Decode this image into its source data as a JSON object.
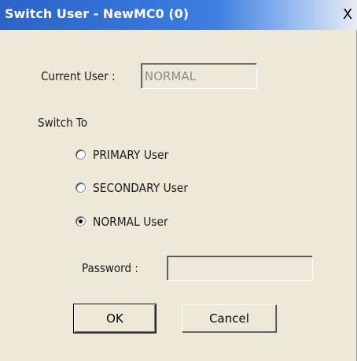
{
  "window": {
    "title": "Switch User - NewMC0 (0)",
    "close_glyph": "X"
  },
  "current_user": {
    "label": "Current User :",
    "value": "NORMAL"
  },
  "switch_to": {
    "label": "Switch To",
    "options": [
      {
        "label": "PRIMARY User",
        "selected": false
      },
      {
        "label": "SECONDARY User",
        "selected": false
      },
      {
        "label": "NORMAL User",
        "selected": true
      }
    ]
  },
  "password": {
    "label": "Password :",
    "value": ""
  },
  "buttons": {
    "ok": "OK",
    "cancel": "Cancel"
  }
}
